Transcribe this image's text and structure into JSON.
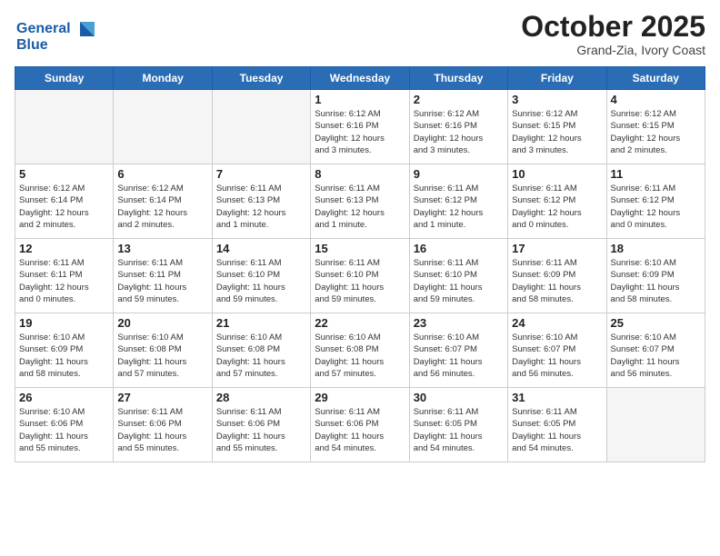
{
  "header": {
    "logo_line1": "General",
    "logo_line2": "Blue",
    "month_title": "October 2025",
    "location": "Grand-Zia, Ivory Coast"
  },
  "weekdays": [
    "Sunday",
    "Monday",
    "Tuesday",
    "Wednesday",
    "Thursday",
    "Friday",
    "Saturday"
  ],
  "weeks": [
    [
      {
        "day": "",
        "info": ""
      },
      {
        "day": "",
        "info": ""
      },
      {
        "day": "",
        "info": ""
      },
      {
        "day": "1",
        "info": "Sunrise: 6:12 AM\nSunset: 6:16 PM\nDaylight: 12 hours\nand 3 minutes."
      },
      {
        "day": "2",
        "info": "Sunrise: 6:12 AM\nSunset: 6:16 PM\nDaylight: 12 hours\nand 3 minutes."
      },
      {
        "day": "3",
        "info": "Sunrise: 6:12 AM\nSunset: 6:15 PM\nDaylight: 12 hours\nand 3 minutes."
      },
      {
        "day": "4",
        "info": "Sunrise: 6:12 AM\nSunset: 6:15 PM\nDaylight: 12 hours\nand 2 minutes."
      }
    ],
    [
      {
        "day": "5",
        "info": "Sunrise: 6:12 AM\nSunset: 6:14 PM\nDaylight: 12 hours\nand 2 minutes."
      },
      {
        "day": "6",
        "info": "Sunrise: 6:12 AM\nSunset: 6:14 PM\nDaylight: 12 hours\nand 2 minutes."
      },
      {
        "day": "7",
        "info": "Sunrise: 6:11 AM\nSunset: 6:13 PM\nDaylight: 12 hours\nand 1 minute."
      },
      {
        "day": "8",
        "info": "Sunrise: 6:11 AM\nSunset: 6:13 PM\nDaylight: 12 hours\nand 1 minute."
      },
      {
        "day": "9",
        "info": "Sunrise: 6:11 AM\nSunset: 6:12 PM\nDaylight: 12 hours\nand 1 minute."
      },
      {
        "day": "10",
        "info": "Sunrise: 6:11 AM\nSunset: 6:12 PM\nDaylight: 12 hours\nand 0 minutes."
      },
      {
        "day": "11",
        "info": "Sunrise: 6:11 AM\nSunset: 6:12 PM\nDaylight: 12 hours\nand 0 minutes."
      }
    ],
    [
      {
        "day": "12",
        "info": "Sunrise: 6:11 AM\nSunset: 6:11 PM\nDaylight: 12 hours\nand 0 minutes."
      },
      {
        "day": "13",
        "info": "Sunrise: 6:11 AM\nSunset: 6:11 PM\nDaylight: 11 hours\nand 59 minutes."
      },
      {
        "day": "14",
        "info": "Sunrise: 6:11 AM\nSunset: 6:10 PM\nDaylight: 11 hours\nand 59 minutes."
      },
      {
        "day": "15",
        "info": "Sunrise: 6:11 AM\nSunset: 6:10 PM\nDaylight: 11 hours\nand 59 minutes."
      },
      {
        "day": "16",
        "info": "Sunrise: 6:11 AM\nSunset: 6:10 PM\nDaylight: 11 hours\nand 59 minutes."
      },
      {
        "day": "17",
        "info": "Sunrise: 6:11 AM\nSunset: 6:09 PM\nDaylight: 11 hours\nand 58 minutes."
      },
      {
        "day": "18",
        "info": "Sunrise: 6:10 AM\nSunset: 6:09 PM\nDaylight: 11 hours\nand 58 minutes."
      }
    ],
    [
      {
        "day": "19",
        "info": "Sunrise: 6:10 AM\nSunset: 6:09 PM\nDaylight: 11 hours\nand 58 minutes."
      },
      {
        "day": "20",
        "info": "Sunrise: 6:10 AM\nSunset: 6:08 PM\nDaylight: 11 hours\nand 57 minutes."
      },
      {
        "day": "21",
        "info": "Sunrise: 6:10 AM\nSunset: 6:08 PM\nDaylight: 11 hours\nand 57 minutes."
      },
      {
        "day": "22",
        "info": "Sunrise: 6:10 AM\nSunset: 6:08 PM\nDaylight: 11 hours\nand 57 minutes."
      },
      {
        "day": "23",
        "info": "Sunrise: 6:10 AM\nSunset: 6:07 PM\nDaylight: 11 hours\nand 56 minutes."
      },
      {
        "day": "24",
        "info": "Sunrise: 6:10 AM\nSunset: 6:07 PM\nDaylight: 11 hours\nand 56 minutes."
      },
      {
        "day": "25",
        "info": "Sunrise: 6:10 AM\nSunset: 6:07 PM\nDaylight: 11 hours\nand 56 minutes."
      }
    ],
    [
      {
        "day": "26",
        "info": "Sunrise: 6:10 AM\nSunset: 6:06 PM\nDaylight: 11 hours\nand 55 minutes."
      },
      {
        "day": "27",
        "info": "Sunrise: 6:11 AM\nSunset: 6:06 PM\nDaylight: 11 hours\nand 55 minutes."
      },
      {
        "day": "28",
        "info": "Sunrise: 6:11 AM\nSunset: 6:06 PM\nDaylight: 11 hours\nand 55 minutes."
      },
      {
        "day": "29",
        "info": "Sunrise: 6:11 AM\nSunset: 6:06 PM\nDaylight: 11 hours\nand 54 minutes."
      },
      {
        "day": "30",
        "info": "Sunrise: 6:11 AM\nSunset: 6:05 PM\nDaylight: 11 hours\nand 54 minutes."
      },
      {
        "day": "31",
        "info": "Sunrise: 6:11 AM\nSunset: 6:05 PM\nDaylight: 11 hours\nand 54 minutes."
      },
      {
        "day": "",
        "info": ""
      }
    ]
  ]
}
